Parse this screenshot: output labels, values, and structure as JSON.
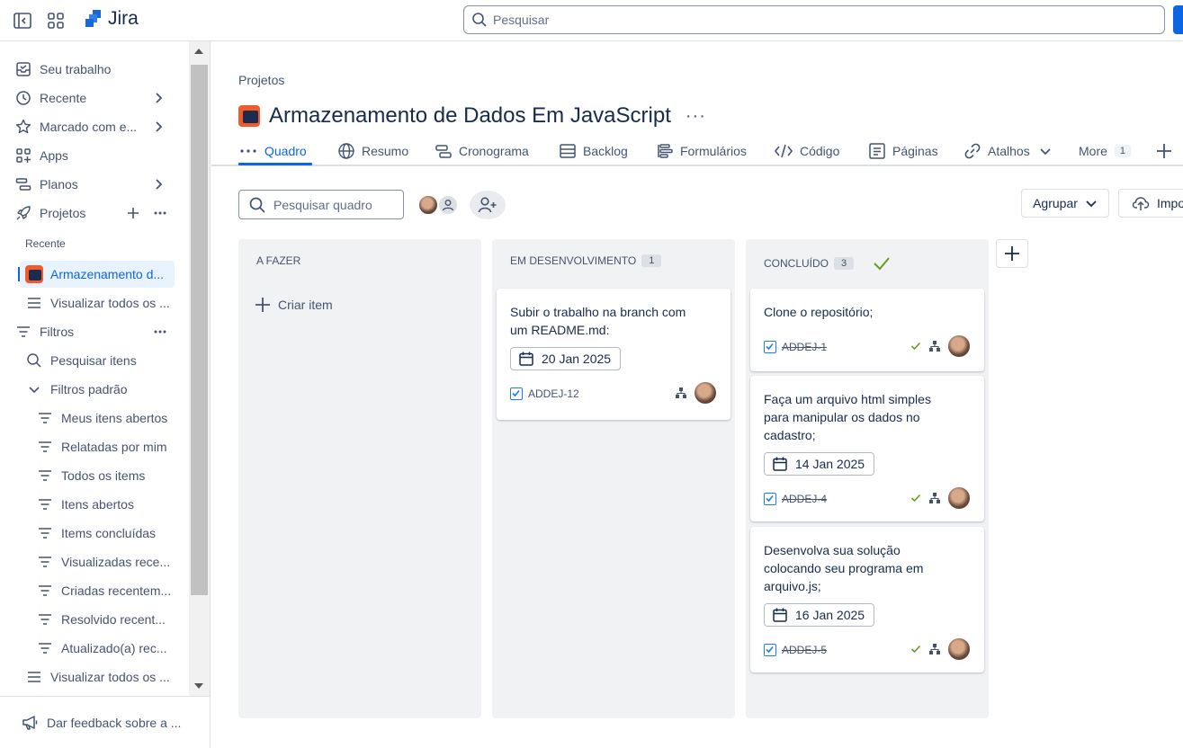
{
  "app": {
    "name": "Jira"
  },
  "search": {
    "placeholder": "Pesquisar"
  },
  "sidebar": {
    "items": [
      {
        "label": "Seu trabalho",
        "icon": "inbox-icon"
      },
      {
        "label": "Recente",
        "icon": "clock-icon"
      },
      {
        "label": "Marcado com e...",
        "icon": "star-icon"
      },
      {
        "label": "Apps",
        "icon": "apps-icon"
      },
      {
        "label": "Planos",
        "icon": "plans-icon"
      },
      {
        "label": "Projetos",
        "icon": "rocket-icon"
      }
    ],
    "recent_header": "Recente",
    "recent_project": "Armazenamento d...",
    "view_all_projects": "Visualizar todos os ...",
    "filters_label": "Filtros",
    "search_items": "Pesquisar itens",
    "default_filters": "Filtros padrão",
    "filter_items": [
      "Meus itens abertos",
      "Relatadas por mim",
      "Todos os items",
      "Itens abertos",
      "Items concluídas",
      "Visualizadas rece...",
      "Criadas recentem...",
      "Resolvido recent...",
      "Atualizado(a) rec..."
    ],
    "view_all_filters": "Visualizar todos os ...",
    "feedback": "Dar feedback sobre a ..."
  },
  "page": {
    "breadcrumb": "Projetos",
    "title": "Armazenamento de Dados Em JavaScript",
    "more": "···"
  },
  "tabs": [
    {
      "label": "Quadro",
      "icon": "board-icon",
      "active": true
    },
    {
      "label": "Resumo",
      "icon": "globe-icon"
    },
    {
      "label": "Cronograma",
      "icon": "timeline-icon"
    },
    {
      "label": "Backlog",
      "icon": "backlog-icon"
    },
    {
      "label": "Formulários",
      "icon": "forms-icon"
    },
    {
      "label": "Código",
      "icon": "code-icon"
    },
    {
      "label": "Páginas",
      "icon": "pages-icon"
    },
    {
      "label": "Atalhos",
      "icon": "link-icon"
    },
    {
      "label": "More",
      "count": "1"
    }
  ],
  "toolbar": {
    "board_search_placeholder": "Pesquisar quadro",
    "group_label": "Agrupar",
    "import_label": "Impo"
  },
  "columns": [
    {
      "title": "A FAZER",
      "count": "",
      "create_label": "Criar item"
    },
    {
      "title": "EM DESENVOLVIMENTO",
      "count": "1"
    },
    {
      "title": "CONCLUÍDO",
      "count": "3"
    }
  ],
  "cards": {
    "dev": [
      {
        "title": "Subir o trabalho na branch com um README.md:",
        "date": "20 Jan 2025",
        "key": "ADDEJ-12"
      }
    ],
    "done": [
      {
        "title": "Clone o repositório;",
        "key": "ADDEJ-1"
      },
      {
        "title": "Faça um arquivo html simples para manipular os dados no cadastro;",
        "date": "14 Jan 2025",
        "key": "ADDEJ-4"
      },
      {
        "title": "Desenvolva sua solução colocando seu programa em arquivo.js;",
        "date": "16 Jan 2025",
        "key": "ADDEJ-5"
      }
    ]
  },
  "colors": {
    "accent": "#0c66e4",
    "done_check": "#6a9a23",
    "project_icon": "#f15b2a"
  }
}
